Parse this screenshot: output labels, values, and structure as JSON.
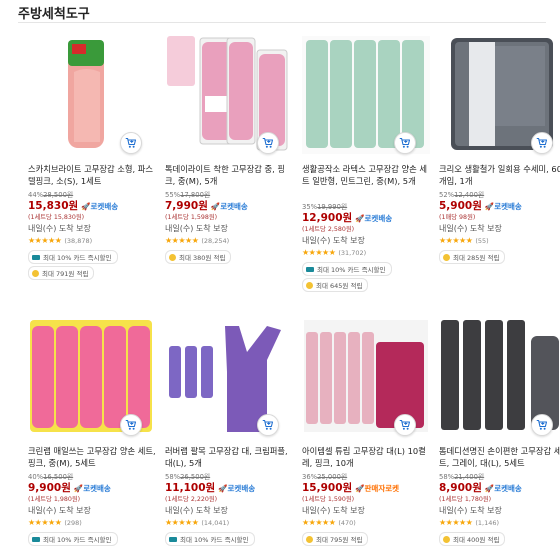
{
  "section_title": "주방세척도구",
  "colors": {
    "price": "#ae0000",
    "rocket": "#2a7cd6",
    "seller_rocket": "#ff6f00",
    "star": "#f7a60a"
  },
  "products": [
    {
      "name": "스카치브라이트 고무장갑 소형, 파스텔핑크, 소(S), 1세트",
      "discount": "44%",
      "original_price": "28,500원",
      "price": "15,830원",
      "delivery_badge": "로켓배송",
      "unit_price": "(1세트당 15,830원)",
      "arrival": "내일(수) 도착 보장",
      "stars": "★★★★★",
      "rating_value": 4.5,
      "review_count": "(38,878)",
      "benefits": [
        {
          "icon": "card-icon",
          "text": "최대 10% 카드 즉시할인"
        },
        {
          "icon": "coin-icon",
          "text": "최대 791원 적립"
        }
      ]
    },
    {
      "name": "톡데이라이트 착한 고무장갑 중, 핑크, 중(M), 5개",
      "discount": "55%",
      "original_price": "17,800원",
      "price": "7,990원",
      "delivery_badge": "로켓배송",
      "unit_price": "(1세트당 1,598원)",
      "arrival": "내일(수) 도착 보장",
      "stars": "★★★★★",
      "rating_value": 5,
      "review_count": "(28,254)",
      "benefits": [
        {
          "icon": "coin-icon",
          "text": "최대 380원 적립"
        }
      ]
    },
    {
      "name": "생활공작소 라텍스 고무장갑 양손 세트 일반형, 민트그린, 중(M), 5개",
      "discount": "35%",
      "original_price": "19,990원",
      "price": "12,900원",
      "delivery_badge": "로켓배송",
      "unit_price": "(1세트당 2,580원)",
      "arrival": "내일(수) 도착 보장",
      "stars": "★★★★★",
      "rating_value": 4.5,
      "review_count": "(31,702)",
      "benefits": [
        {
          "icon": "card-icon",
          "text": "최대 10% 카드 즉시할인"
        },
        {
          "icon": "coin-icon",
          "text": "최대 645원 적립"
        }
      ]
    },
    {
      "name": "크리오 생활철가 일회용 수세미, 60개입, 1개",
      "discount": "52%",
      "original_price": "12,400원",
      "price": "5,900원",
      "delivery_badge": "로켓배송",
      "unit_price": "(1매당 98원)",
      "arrival": "내일(수) 도착 보장",
      "stars": "★★★★★",
      "rating_value": 5,
      "review_count": "(55)",
      "benefits": [
        {
          "icon": "coin-icon",
          "text": "최대 285원 적립"
        }
      ]
    },
    {
      "name": "크린랩 매일쓰는 고무장갑 양손 세트, 핑크, 중(M), 5세트",
      "discount": "40%",
      "original_price": "16,500원",
      "price": "9,900원",
      "delivery_badge": "로켓배송",
      "unit_price": "(1세트당 1,980원)",
      "arrival": "내일(수) 도착 보장",
      "stars": "★★★★★",
      "rating_value": 4.5,
      "review_count": "(298)",
      "benefits": [
        {
          "icon": "card-icon",
          "text": "최대 10% 카드 즉시할인"
        }
      ]
    },
    {
      "name": "러버랩 팔목 고무장갑 대, 크림퍼플, 대(L), 5개",
      "discount": "58%",
      "original_price": "26,500원",
      "price": "11,100원",
      "delivery_badge": "로켓배송",
      "unit_price": "(1세트당 2,220원)",
      "arrival": "내일(수) 도착 보장",
      "stars": "★★★★★",
      "rating_value": 4.5,
      "review_count": "(14,041)",
      "benefits": [
        {
          "icon": "card-icon",
          "text": "최대 10% 카드 즉시할인"
        }
      ]
    },
    {
      "name": "아이템셀 튜립 고무장갑 대(L) 10켤레, 핑크, 10개",
      "discount": "36%",
      "original_price": "25,000원",
      "price": "15,900원",
      "delivery_badge": "판매자로켓",
      "unit_price": "(1세트당 1,590원)",
      "arrival": "내일(수) 도착 보장",
      "stars": "★★★★★",
      "rating_value": 4.5,
      "review_count": "(470)",
      "benefits": [
        {
          "icon": "coin-icon",
          "text": "최대 795원 적립"
        }
      ]
    },
    {
      "name": "톰데디션명진 손이편한 고무장갑 세트, 그레이, 대(L), 5세트",
      "discount": "58%",
      "original_price": "21,400원",
      "price": "8,900원",
      "delivery_badge": "로켓배송",
      "unit_price": "(1세트당 1,780원)",
      "arrival": "내일(수) 도착 보장",
      "stars": "★★★★★",
      "rating_value": 4.5,
      "review_count": "(1,146)",
      "benefits": [
        {
          "icon": "coin-icon",
          "text": "최대 400원 적립"
        }
      ]
    }
  ]
}
